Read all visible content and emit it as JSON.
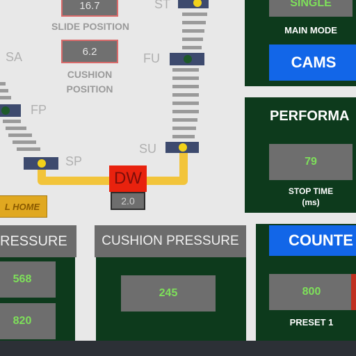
{
  "diagram": {
    "slide_position_value": "16.7",
    "slide_position_label": "SLIDE POSITION",
    "cushion_position_value": "6.2",
    "cushion_position_label_1": "CUSHION",
    "cushion_position_label_2": "POSITION",
    "label_st": "ST",
    "label_sa": "SA",
    "label_fu": "FU",
    "label_fp": "FP",
    "label_su": "SU",
    "label_sp": "SP",
    "dw_label": "DW",
    "dw_value": "2.0",
    "home_button": "L HOME"
  },
  "mode_panel": {
    "mode_value": "SINGLE",
    "mode_label": "MAIN MODE",
    "cams_button": "CAMS"
  },
  "performance_panel": {
    "title": "PERFORMA",
    "stop_time_value": "79",
    "stop_time_label_1": "STOP TIME",
    "stop_time_label_2": "(ms)"
  },
  "pressure_panel": {
    "header": "RESSURE",
    "value_1": "568",
    "value_2": "820"
  },
  "cushion_panel": {
    "header": "CUSHION PRESSURE",
    "value": "245"
  },
  "counter_panel": {
    "button": "COUNTE",
    "preset_value": "800",
    "preset_label": "PRESET 1"
  },
  "colors": {
    "panel_green": "#0d3a1c",
    "accent_blue": "#1266e8",
    "value_green": "#7ee05a",
    "path_yellow": "#f2c43a",
    "dw_red": "#e8220e"
  }
}
